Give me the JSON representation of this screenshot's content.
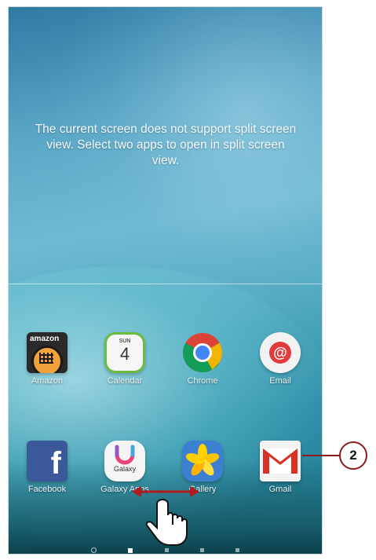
{
  "screen": {
    "message": "The current screen does not support split screen view. Select two apps to open in split screen view."
  },
  "apps": [
    {
      "label": "Amazon",
      "icon": "amazon-icon",
      "logo_text": "amazon"
    },
    {
      "label": "Calendar",
      "icon": "calendar-icon",
      "day": "SUN",
      "date": "4"
    },
    {
      "label": "Chrome",
      "icon": "chrome-icon"
    },
    {
      "label": "Email",
      "icon": "email-icon",
      "glyph": "@"
    },
    {
      "label": "Facebook",
      "icon": "facebook-icon",
      "glyph": "f"
    },
    {
      "label": "Galaxy Apps",
      "icon": "galaxy-apps-icon",
      "logo_text": "Galaxy"
    },
    {
      "label": "Gallery",
      "icon": "gallery-icon"
    },
    {
      "label": "Gmail",
      "icon": "gmail-icon"
    }
  ],
  "page_indicator": {
    "pages": 4,
    "active_index": 0,
    "has_home_marker": true
  },
  "callout": {
    "number": "2"
  },
  "colors": {
    "callout": "#8b1a1a",
    "gesture_arrow": "#b01c1c"
  }
}
